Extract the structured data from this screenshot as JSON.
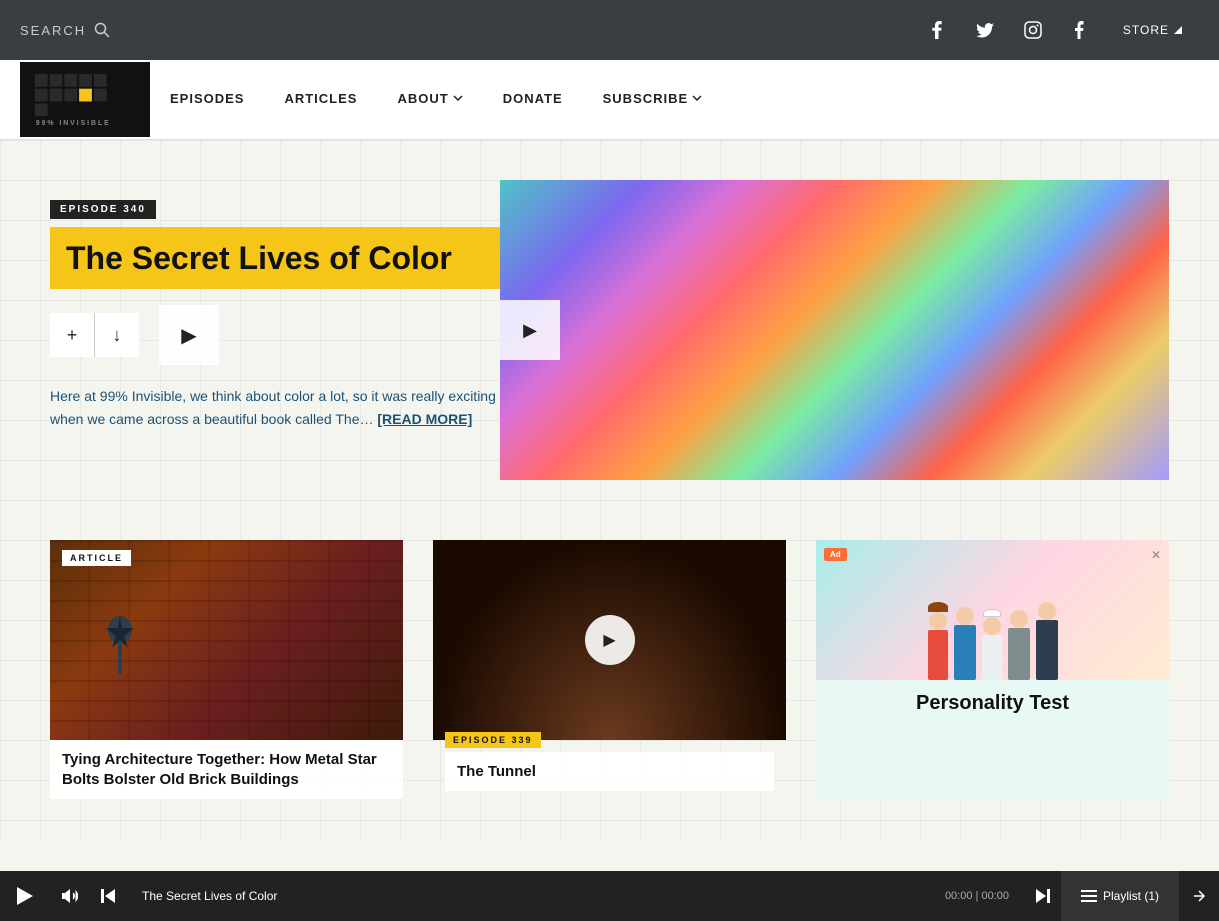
{
  "topbar": {
    "search_label": "SEARCH",
    "store_label": "STORE",
    "social_links": [
      "facebook",
      "twitter",
      "instagram",
      "tumblr"
    ]
  },
  "nav": {
    "logo_text": "99% INVISIBLE",
    "items": [
      {
        "label": "EPISODES",
        "id": "episodes"
      },
      {
        "label": "ARTICLES",
        "id": "articles"
      },
      {
        "label": "ABOUT",
        "id": "about",
        "has_dropdown": true
      },
      {
        "label": "DONATE",
        "id": "donate"
      },
      {
        "label": "SUBSCRIBE",
        "id": "subscribe",
        "has_dropdown": true
      }
    ]
  },
  "hero": {
    "episode_badge": "EPISODE 340",
    "title": "The Secret Lives of Color",
    "add_label": "+",
    "download_label": "↓",
    "description": "Here at 99% Invisible, we think about color a lot, so it was really exciting when we came across a beautiful book called The…",
    "read_more": "[READ MORE]"
  },
  "cards": [
    {
      "type": "ARTICLE",
      "title": "Tying Architecture Together: How Metal Star Bolts Bolster Old Brick Buildings",
      "image_type": "brick"
    },
    {
      "episode_badge": "EPISODE 339",
      "title": "The Tunnel",
      "image_type": "tunnel",
      "has_play": true
    },
    {
      "ad": true,
      "ad_title": "Personality Test",
      "ad_badge": "Ad"
    }
  ],
  "player": {
    "track_title": "The Secret Lives of Color",
    "time_current": "00:00",
    "time_total": "00:00",
    "playlist_label": "Playlist (1)"
  }
}
